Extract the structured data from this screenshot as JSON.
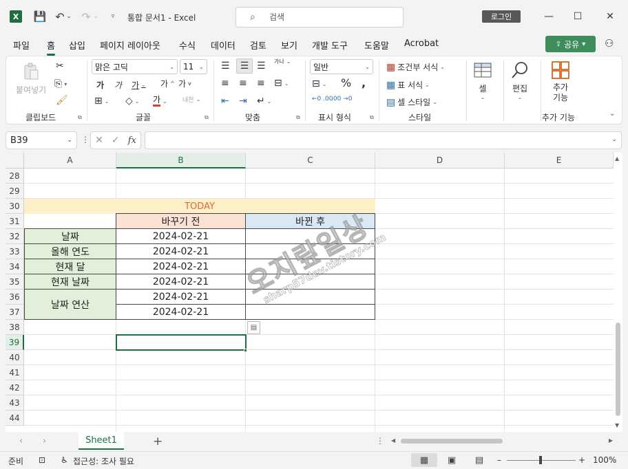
{
  "titlebar": {
    "app_logo": "X",
    "doc_title": "통합 문서1  -  Excel",
    "search_placeholder": "검색",
    "login_label": "로그인",
    "minimize": "—",
    "maximize": "☐",
    "close": "✕"
  },
  "menu": {
    "tabs": [
      "파일",
      "홈",
      "삽입",
      "페이지 레이아웃",
      "수식",
      "데이터",
      "검토",
      "보기",
      "개발 도구",
      "도움말",
      "Acrobat"
    ],
    "active": "홈",
    "share_label": "공유"
  },
  "ribbon": {
    "clipboard": {
      "label": "클립보드",
      "paste": "붙여넣기"
    },
    "font": {
      "label": "글꼴",
      "name": "맑은 고딕",
      "size": "11",
      "bold": "가",
      "italic": "가",
      "underline": "가",
      "grow": "가",
      "shrink": "가",
      "color_glyph": "가",
      "phonetic": "내천"
    },
    "alignment": {
      "label": "맞춤",
      "wrap": "가나"
    },
    "number": {
      "label": "표시 형식",
      "format": "일반"
    },
    "styles": {
      "label": "스타일",
      "conditional": "조건부 서식",
      "table": "표 서식",
      "cell_styles": "셀 스타일"
    },
    "cells": {
      "label": "셀"
    },
    "editing": {
      "label": "편집"
    },
    "addins": {
      "label": "추가 기능",
      "button": "추가 기능"
    }
  },
  "formula_bar": {
    "name_box": "B39",
    "value": ""
  },
  "grid": {
    "columns": [
      "A",
      "B",
      "C",
      "D",
      "E"
    ],
    "rows": [
      "28",
      "29",
      "30",
      "31",
      "32",
      "33",
      "34",
      "35",
      "36",
      "37",
      "38",
      "39",
      "40",
      "41",
      "42",
      "43",
      "44"
    ],
    "selected_cell": "B39",
    "today": "TODAY",
    "header_before": "바꾸기 전",
    "header_after": "바뀐 후",
    "labels": [
      "날짜",
      "올해 연도",
      "현재 달",
      "현재 날짜",
      "날짜 연산"
    ],
    "values": [
      "2024-02-21",
      "2024-02-21",
      "2024-02-21",
      "2024-02-21",
      "2024-02-21",
      "2024-02-21"
    ]
  },
  "watermark": {
    "main": "오지랖일상",
    "sub": "sharp57dev.tistory.com"
  },
  "sheets": {
    "tabs": [
      "Sheet1"
    ],
    "active": "Sheet1"
  },
  "status": {
    "ready": "준비",
    "accessibility": "접근성: 조사 필요",
    "zoom": "100%"
  },
  "colors": {
    "accent": "#1d6f42",
    "today_bg": "#fdefc7",
    "today_text": "#e4663b",
    "before_bg": "#fbe2d5",
    "after_bg": "#dae7f5",
    "label_bg": "#e2efd9"
  }
}
